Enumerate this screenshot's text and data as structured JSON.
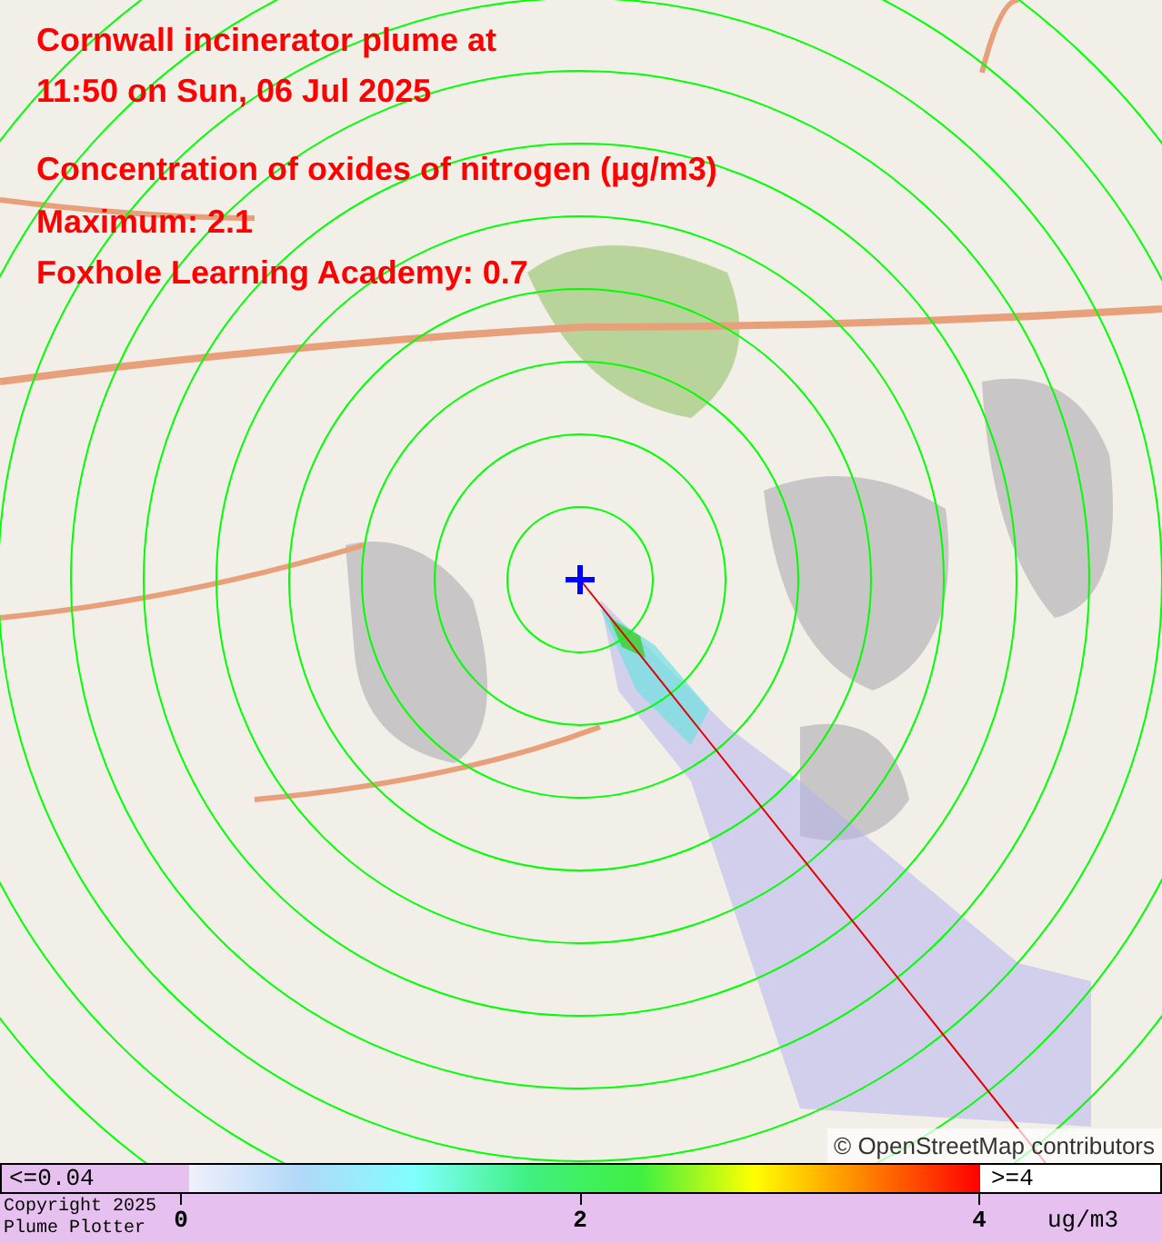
{
  "title_lines": [
    "Cornwall incinerator plume at",
    "11:50 on Sun, 06 Jul 2025"
  ],
  "info_lines": [
    "Concentration of oxides of nitrogen (µg/m3)",
    "Maximum: 2.1",
    "Foxhole Learning Academy: 0.7"
  ],
  "attribution": "© OpenStreetMap contributors",
  "legend": {
    "low_label": "<=0.04",
    "high_label": ">=4",
    "ticks": [
      "0",
      "2",
      "4"
    ],
    "unit": "ug/m3"
  },
  "copyright_lines": [
    "Copyright 2025",
    "Plume Plotter"
  ]
}
